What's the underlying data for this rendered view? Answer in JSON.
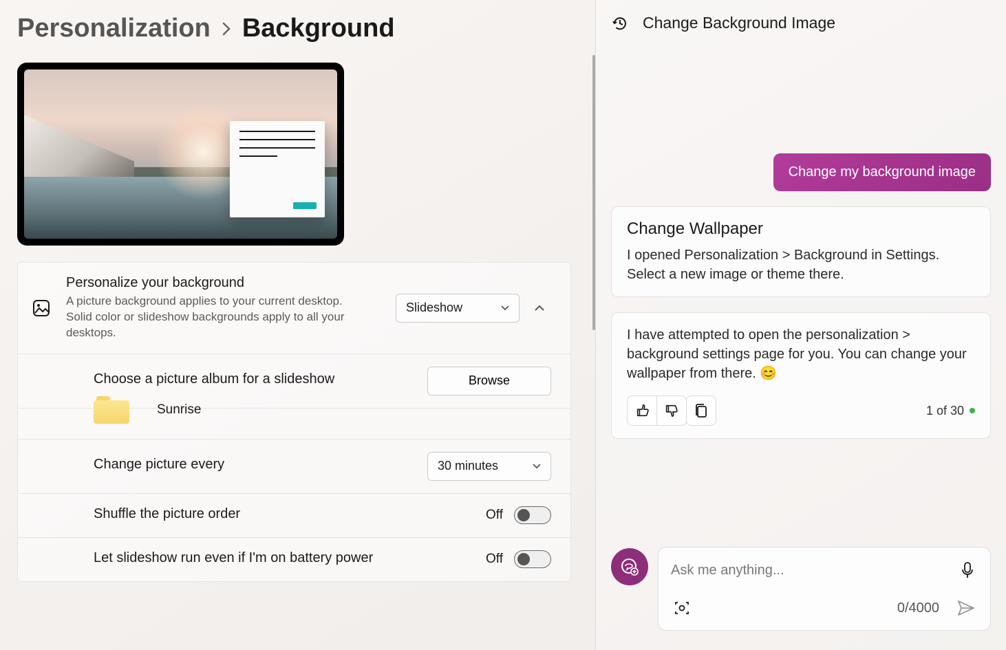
{
  "breadcrumb": {
    "parent": "Personalization",
    "current": "Background"
  },
  "settings": {
    "personalize": {
      "title": "Personalize your background",
      "desc": "A picture background applies to your current desktop. Solid color or slideshow backgrounds apply to all your desktops.",
      "value": "Slideshow"
    },
    "album": {
      "title": "Choose a picture album for a slideshow",
      "browse": "Browse",
      "folder": "Sunrise"
    },
    "interval": {
      "title": "Change picture every",
      "value": "30 minutes"
    },
    "shuffle": {
      "title": "Shuffle the picture order",
      "value": "Off"
    },
    "battery": {
      "title": "Let slideshow run even if I'm on battery power",
      "value": "Off"
    }
  },
  "copilot": {
    "header": "Change Background Image",
    "user_msg": "Change my background image",
    "card": {
      "title": "Change Wallpaper",
      "body": "I opened Personalization > Background in Settings. Select a new image or theme there."
    },
    "followup": "I have attempted to open the personalization > background settings page for you. You can change your wallpaper from there. 😊",
    "counter": "1 of 30",
    "input_placeholder": "Ask me anything...",
    "char_count": "0/4000"
  }
}
